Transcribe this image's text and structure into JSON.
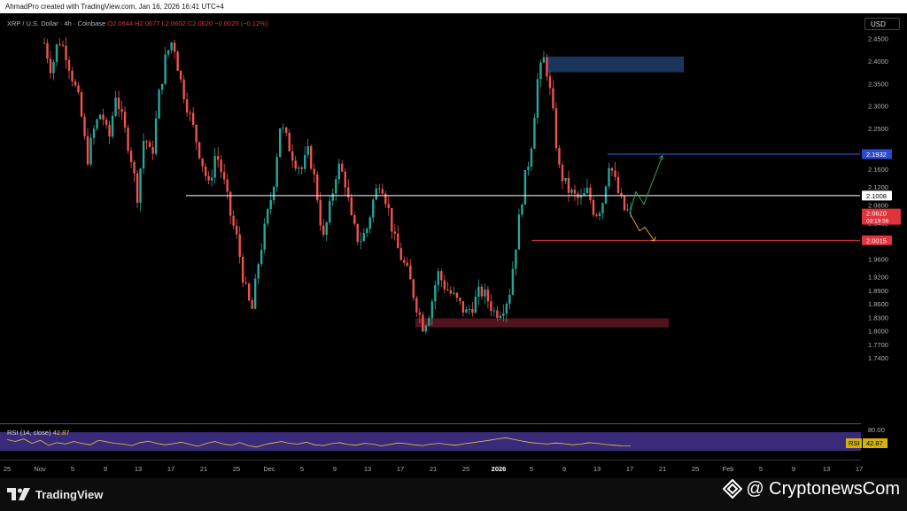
{
  "header": {
    "credit": "AhmadPro created with TradingView.com, Jan 16, 2026 16:41 UTC+4"
  },
  "symbol": {
    "name": "XRP / U.S. Dollar · 4h · Coinbase",
    "o_label": "O",
    "o_value": "2.0644",
    "h_label": "H",
    "h_value": "2.0677",
    "l_label": "L",
    "l_value": "2.0602",
    "c_label": "C",
    "c_value": "2.0620",
    "change": "−0.0025 (−0.12%)"
  },
  "currency": "USD",
  "footer": {
    "brand": "TradingView",
    "watermark": "@ CryptonewsCom"
  },
  "colors": {
    "up": "#26a69a",
    "down": "#ef5350",
    "rsi_line": "#e8c840",
    "rsi_bg": "#3a2a7a",
    "resistance": "#1e3a66",
    "support": "#5a1620",
    "current_price": "#e0333b"
  },
  "chart_data": {
    "type": "candlestick",
    "timeframe": "4h",
    "ylim": [
      1.74,
      2.45
    ],
    "y_ticks": [
      "2.4500",
      "2.4000",
      "2.3500",
      "2.3000",
      "2.2500",
      "2.2000",
      "2.1600",
      "2.1200",
      "2.0800",
      "2.0400",
      "1.9600",
      "1.9200",
      "1.8900",
      "1.8600",
      "1.8300",
      "1.8000",
      "1.7700",
      "1.7400"
    ],
    "x_ticks": [
      "25",
      "Nov",
      "5",
      "9",
      "13",
      "17",
      "21",
      "25",
      "Dec",
      "5",
      "9",
      "13",
      "17",
      "21",
      "25",
      "2026",
      "5",
      "9",
      "13",
      "17",
      "21",
      "25",
      "Feb",
      "5",
      "9",
      "13",
      "17"
    ],
    "price_path": [
      2.44,
      2.38,
      2.45,
      2.42,
      2.36,
      2.3,
      2.18,
      2.25,
      2.29,
      2.22,
      2.33,
      2.26,
      2.2,
      2.1,
      2.24,
      2.18,
      2.32,
      2.41,
      2.45,
      2.36,
      2.3,
      2.24,
      2.18,
      2.12,
      2.2,
      2.14,
      2.06,
      2.0,
      1.9,
      1.84,
      1.96,
      2.04,
      2.12,
      2.26,
      2.22,
      2.18,
      2.16,
      2.2,
      2.12,
      2.0,
      2.08,
      2.17,
      2.14,
      2.04,
      2.0,
      2.02,
      2.09,
      2.14,
      2.08,
      2.0,
      1.96,
      1.92,
      1.86,
      1.81,
      1.85,
      1.93,
      1.9,
      1.88,
      1.86,
      1.84,
      1.86,
      1.89,
      1.87,
      1.84,
      1.85,
      1.88,
      2.0,
      2.12,
      2.2,
      2.36,
      2.41,
      2.3,
      2.16,
      2.12,
      2.1,
      2.09,
      2.11,
      2.06,
      2.08,
      2.18,
      2.12,
      2.07,
      2.062
    ],
    "levels": [
      {
        "label": "2.1932",
        "value": 2.1932
      },
      {
        "label": "2.1008",
        "value": 2.1008
      },
      {
        "label": "2.0015",
        "value": 2.0015
      }
    ],
    "current_price": {
      "label": "2.0620",
      "countdown": "03:19:56",
      "value": 2.062
    },
    "zones": [
      {
        "name": "resistance",
        "y_low": 2.375,
        "y_high": 2.41
      },
      {
        "name": "support",
        "y_low": 1.808,
        "y_high": 1.828
      }
    ],
    "rsi": {
      "label": "RSI (14, close)",
      "value": "42.87",
      "badge": "RSI",
      "level_label": "80.00",
      "path": [
        60,
        55,
        62,
        50,
        58,
        45,
        52,
        48,
        55,
        50,
        46,
        58,
        54,
        50,
        48,
        44,
        52,
        56,
        50,
        46,
        49,
        53,
        47,
        42,
        50,
        55,
        48,
        45,
        52,
        44,
        40,
        47,
        51,
        55,
        50,
        48,
        53,
        46,
        44,
        49,
        52,
        47,
        45,
        50,
        48,
        43,
        47,
        51,
        49,
        46,
        44,
        48,
        50,
        47,
        45,
        49,
        52,
        55,
        58,
        62,
        65,
        60,
        56,
        52,
        50,
        48,
        51,
        49,
        46,
        48,
        52,
        50,
        47,
        45,
        43,
        42.87
      ]
    }
  }
}
